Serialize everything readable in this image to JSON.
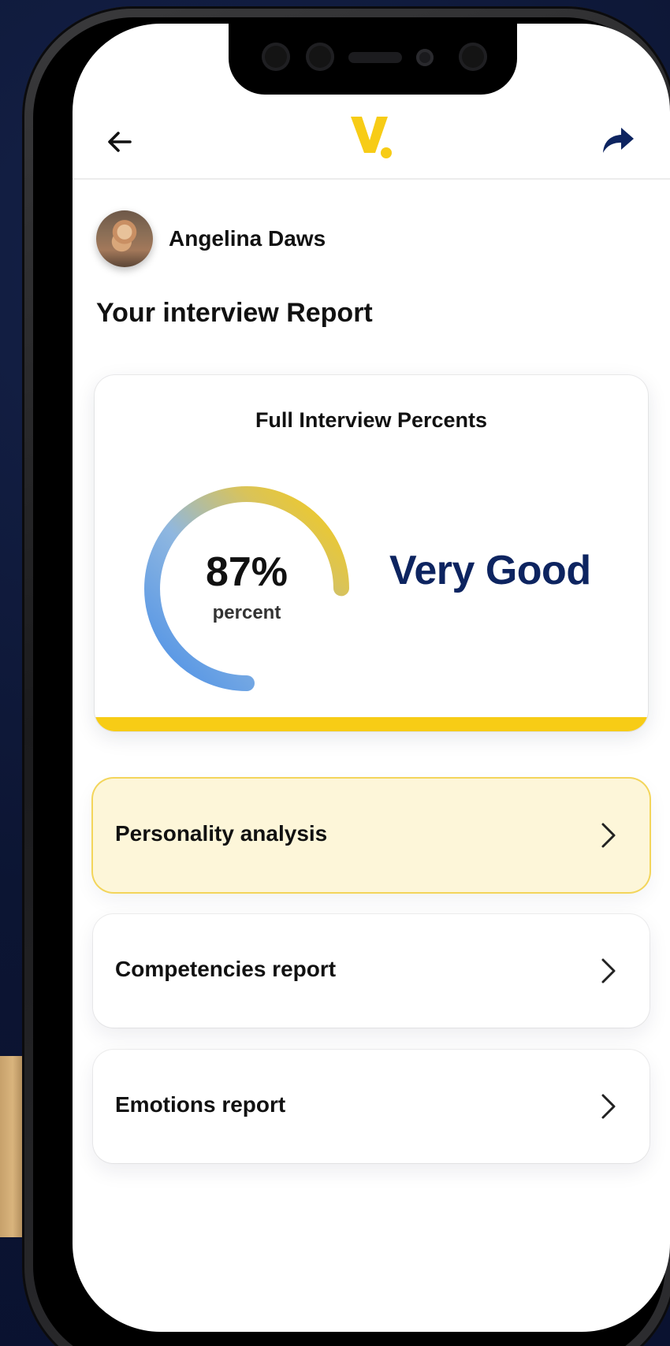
{
  "header": {
    "logo_text": "V.",
    "back_icon": "arrow-left-icon",
    "share_icon": "share-arrow-icon"
  },
  "profile": {
    "name": "Angelina Daws"
  },
  "page": {
    "title": "Your interview Report"
  },
  "score_card": {
    "title": "Full Interview Percents",
    "value": "87%",
    "value_number": 87,
    "unit": "percent",
    "rating": "Very Good"
  },
  "menu": {
    "items": [
      {
        "label": "Personality analysis",
        "active": true
      },
      {
        "label": "Competencies report",
        "active": false
      },
      {
        "label": "Emotions report",
        "active": false
      }
    ]
  },
  "colors": {
    "brand_yellow": "#f7cc16",
    "brand_navy": "#0d2460",
    "gauge_start": "#4a8fe7",
    "gauge_end": "#f7cc16",
    "active_item_bg": "#fdf6d9"
  }
}
